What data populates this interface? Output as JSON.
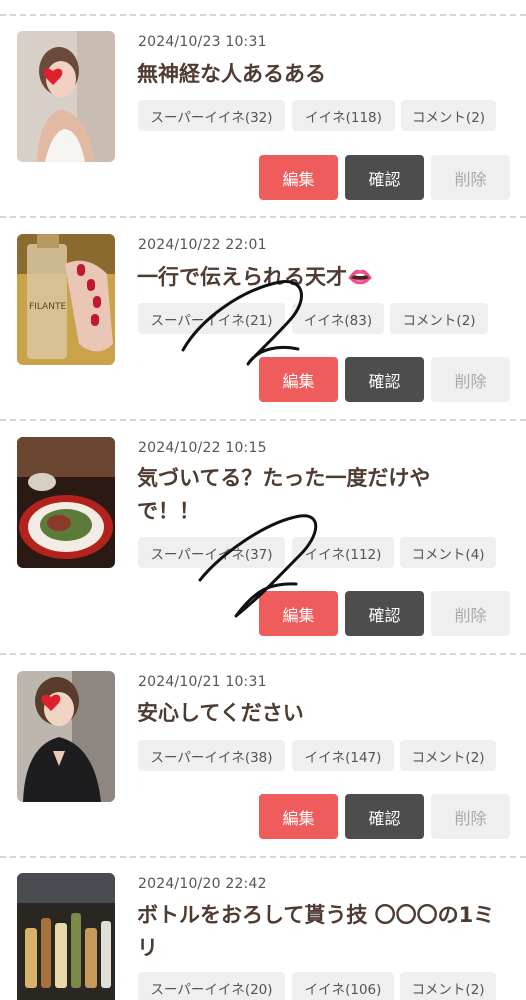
{
  "posts": [
    {
      "date": "2024/10/23 10:31",
      "title": "無神経な人あるある",
      "super_like": "スーパーイイネ(32)",
      "like": "イイネ(118)",
      "comment": "コメント(2)",
      "thumb_kind": "woman-white-top"
    },
    {
      "date": "2024/10/22 22:01",
      "title": "一行で伝えられる天才👄",
      "super_like": "スーパーイイネ(21)",
      "like": "イイネ(83)",
      "comment": "コメント(2)",
      "thumb_kind": "perfume-bottle"
    },
    {
      "date": "2024/10/22 10:15",
      "title": "気づいてる？たった一度だけやで！！",
      "super_like": "スーパーイイネ(37)",
      "like": "イイネ(112)",
      "comment": "コメント(4)",
      "thumb_kind": "dish-plate"
    },
    {
      "date": "2024/10/21 10:31",
      "title": "安心してください",
      "super_like": "スーパーイイネ(38)",
      "like": "イイネ(147)",
      "comment": "コメント(2)",
      "thumb_kind": "woman-black-dress"
    },
    {
      "date": "2024/10/20 22:42",
      "title": "ボトルをおろして貰う技 〇〇〇の1ミリ",
      "super_like": "スーパーイイネ(20)",
      "like": "イイネ(106)",
      "comment": "コメント(2)",
      "thumb_kind": "bottles-bar"
    }
  ],
  "buttons": {
    "edit": "編集",
    "confirm": "確認",
    "delete": "削除"
  },
  "colors": {
    "edit_bg": "#ee5c5c",
    "confirm_bg": "#4d4d4d",
    "delete_bg": "#efefef",
    "tag_bg": "#efefef",
    "title_text": "#4f3b30"
  }
}
